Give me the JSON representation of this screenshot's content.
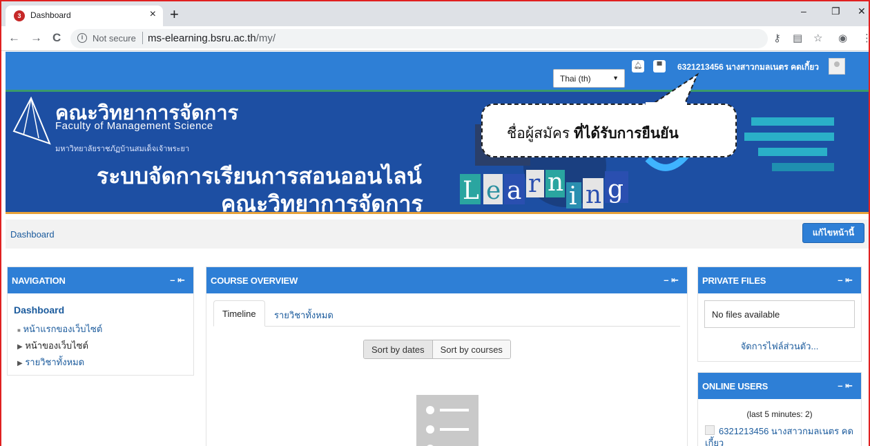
{
  "browser": {
    "tab_title": "Dashboard",
    "favicon_text": "3",
    "tab_close": "×",
    "new_tab": "+",
    "minimize": "–",
    "restore": "❐",
    "close": "✕",
    "not_secure": "Not secure",
    "url_host": "ms-elearning.bsru.ac.th",
    "url_path": "/my/",
    "back": "←",
    "forward": "→",
    "reload": "C"
  },
  "header": {
    "language": "Thai (th)",
    "user_name": "6321213456 นางสาวกมลเนตร คดเกี้ยว"
  },
  "banner": {
    "faculty_th": "คณะวิทยาการจัดการ",
    "faculty_en": "Faculty of Management Science",
    "university": "มหาวิทยาลัยราชภัฏบ้านสมเด็จเจ้าพระยา",
    "system_line1": "ระบบจัดการเรียนการสอนออนไลน์",
    "system_line2": "คณะวิทยาการจัดการ",
    "learning_letters": [
      "L",
      "e",
      "a",
      "r",
      "n",
      "i",
      "n",
      "g"
    ]
  },
  "callout": {
    "normal": "ชื่อผู้สมัคร ",
    "bold": "ที่ได้รับการยืนยัน"
  },
  "breadcrumb": "Dashboard",
  "edit_button": "แก้ไขหน้านี้",
  "navigation": {
    "title": "NAVIGATION",
    "controls": "– ⇤",
    "items": [
      {
        "label": "Dashboard"
      },
      {
        "label": "หน้าแรกของเว็บไซต์"
      },
      {
        "label": "หน้าของเว็บไซต์"
      },
      {
        "label": "รายวิชาทั้งหมด"
      }
    ]
  },
  "course_overview": {
    "title": "COURSE OVERVIEW",
    "controls": "– ⇤",
    "tabs": [
      {
        "label": "Timeline"
      },
      {
        "label": "รายวิชาทั้งหมด"
      }
    ],
    "sort_dates": "Sort by dates",
    "sort_courses": "Sort by courses"
  },
  "private_files": {
    "title": "PRIVATE FILES",
    "controls": "– ⇤",
    "empty": "No files available",
    "manage": "จัดการไฟล์ส่วนตัว..."
  },
  "online_users": {
    "title": "ONLINE USERS",
    "controls": "– ⇤",
    "period": "(last 5 minutes: 2)",
    "user": "6321213456 นางสาวกมลเนตร คดเกี้ยว"
  },
  "colors": {
    "accent": "#2e7fd6",
    "banner": "#1d4fa3",
    "link": "#1a5a9c"
  }
}
